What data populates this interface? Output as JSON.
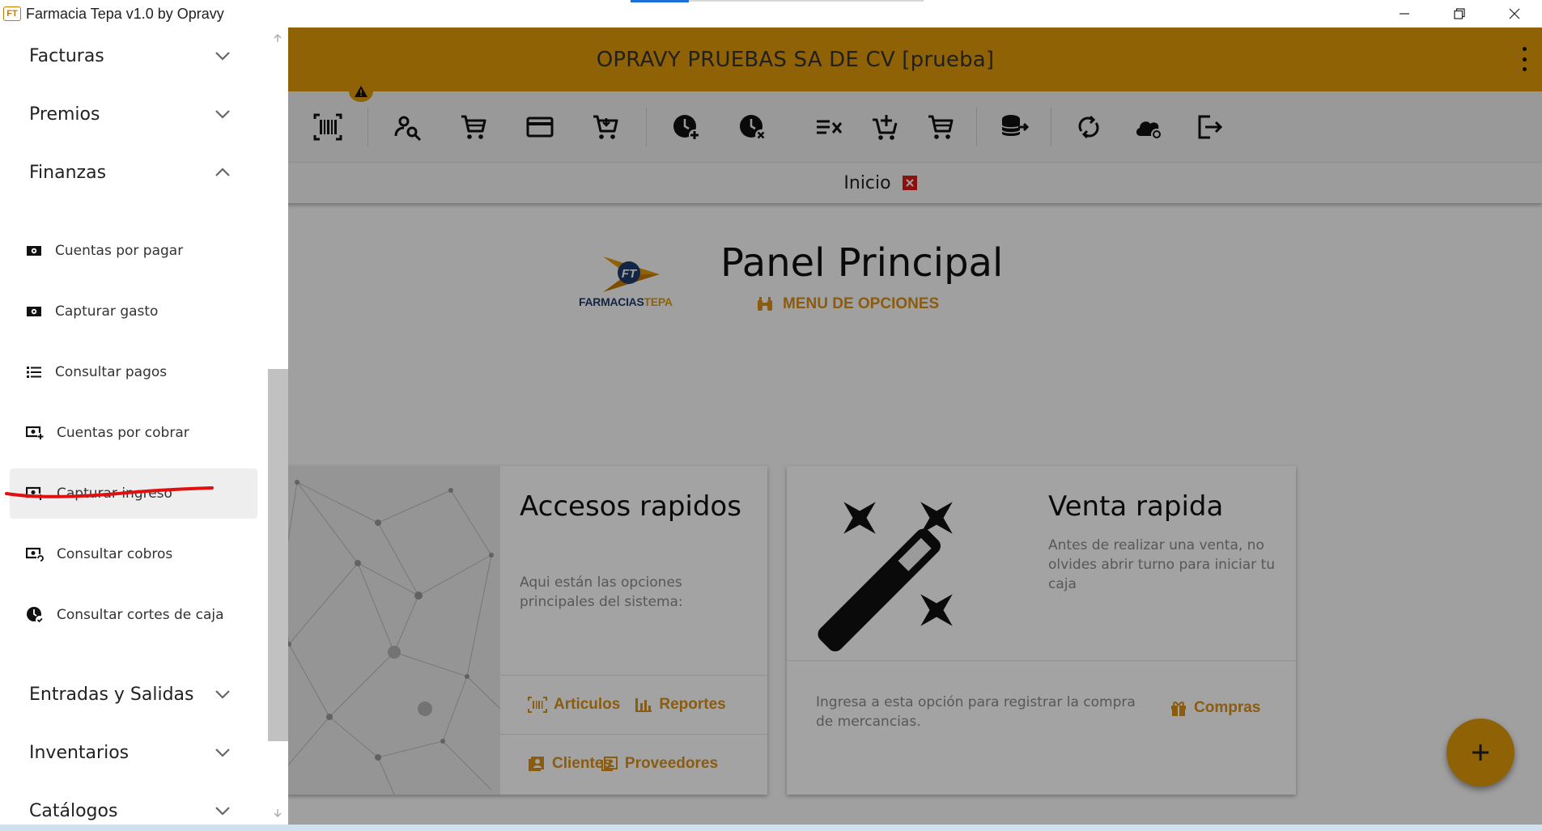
{
  "window": {
    "title": "Farmacia Tepa v1.0 by Opravy",
    "icon_text": "FT"
  },
  "appbar": {
    "company": "OPRAVY PRUEBAS SA DE CV [prueba]"
  },
  "colors": {
    "accent": "#e09a0a",
    "link": "#d9901a",
    "close_tab": "#d91a1a",
    "underline": "#e01010"
  },
  "tabs": [
    {
      "label": "Inicio"
    }
  ],
  "panel": {
    "title": "Panel Principal",
    "subtitle": "MENU DE OPCIONES",
    "logo_brand_dark": "FARMACIAS",
    "logo_brand_accent": "TEPA",
    "logo_mark": "FT"
  },
  "cards": {
    "accesos": {
      "title": "Accesos rapidos",
      "description": "Aqui están las opciones principales del sistema:",
      "links": [
        "Articulos",
        "Reportes",
        "Clientes",
        "Proveedores"
      ]
    },
    "venta": {
      "title": "Venta rapida",
      "description": "Antes de realizar una venta, no olvides abrir turno para iniciar tu caja",
      "footer": "Ingresa a esta opción para registrar la compra de mercancias.",
      "link": "Compras"
    }
  },
  "drawer": {
    "sections": [
      {
        "label": "Facturas",
        "expanded": false
      },
      {
        "label": "Premios",
        "expanded": false
      },
      {
        "label": "Finanzas",
        "expanded": true
      },
      {
        "label": "Entradas y Salidas",
        "expanded": false
      },
      {
        "label": "Inventarios",
        "expanded": false
      },
      {
        "label": "Catálogos",
        "expanded": false
      }
    ],
    "finanzas_items": [
      {
        "label": "Cuentas por pagar",
        "icon": "cash-icon"
      },
      {
        "label": "Capturar gasto",
        "icon": "cash-icon"
      },
      {
        "label": "Consultar pagos",
        "icon": "list-icon"
      },
      {
        "label": "Cuentas por cobrar",
        "icon": "cash-plus-icon"
      },
      {
        "label": "Capturar ingreso",
        "icon": "cash-plus-icon",
        "active": true
      },
      {
        "label": "Consultar cobros",
        "icon": "cash-refresh-icon"
      },
      {
        "label": "Consultar cortes de caja",
        "icon": "clock-check-icon"
      }
    ]
  },
  "toolbar_icons": [
    "barcode-icon",
    "search-user-icon",
    "cart-icon",
    "card-icon",
    "cart-arrow-icon",
    "clock-plus-icon",
    "clock-x-icon",
    "list-remove-icon",
    "cart-plus-icon",
    "cart-icon",
    "database-export-icon",
    "sync-icon",
    "cloud-sync-icon",
    "logout-icon"
  ]
}
